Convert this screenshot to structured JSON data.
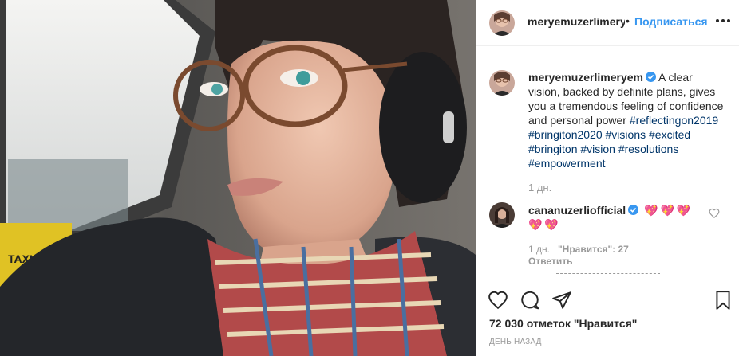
{
  "post": {
    "image_alt": "Woman wearing glasses, ear muffs and a plaid scarf sitting in a car"
  },
  "header": {
    "username": "meryemuzerlimeryem",
    "dot": "•",
    "follow_label": "Подписаться",
    "more_icon": "more-horizontal-icon"
  },
  "caption": {
    "username": "meryemuzerlimeryem",
    "text": "A clear vision, backed by definite plans, gives you a tremendous feeling of confidence and personal power",
    "hashtags": "#reflectingon2019 #bringiton2020 #visions #excited #bringiton #vision #resolutions #empowerment",
    "time": "1 дн."
  },
  "comment": {
    "username": "cananuzerliofficial",
    "hearts": "💖💖💖💖💖",
    "time": "1 дн.",
    "likes": "\"Нравится\": 27",
    "reply_label": "Ответить"
  },
  "actions": {
    "likes_count": "72 030 отметок \"Нравится\"",
    "post_time": "ДЕНЬ НАЗАД"
  },
  "colors": {
    "link_blue": "#3897f0",
    "hashtag": "#003569",
    "muted": "#999999",
    "verified": "#3897f0"
  }
}
